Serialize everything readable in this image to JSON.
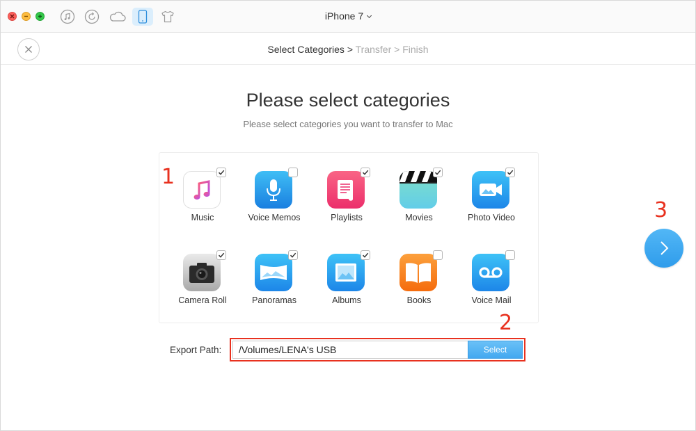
{
  "window": {
    "device_name": "iPhone 7"
  },
  "toolbar": {
    "icons": [
      "music-note-icon",
      "refresh-icon",
      "cloud-icon",
      "phone-icon",
      "shirt-icon"
    ],
    "active": "phone-icon"
  },
  "breadcrumb": {
    "step1": "Select Categories",
    "sep1": " > ",
    "step2": "Transfer",
    "sep2": " > ",
    "step3": "Finish"
  },
  "main": {
    "title": "Please select categories",
    "subtitle": "Please select categories you want to transfer to Mac"
  },
  "categories": [
    {
      "label": "Music",
      "checked": true
    },
    {
      "label": "Voice Memos",
      "checked": false
    },
    {
      "label": "Playlists",
      "checked": true
    },
    {
      "label": "Movies",
      "checked": true
    },
    {
      "label": "Photo Video",
      "checked": true
    },
    {
      "label": "Camera Roll",
      "checked": true
    },
    {
      "label": "Panoramas",
      "checked": true
    },
    {
      "label": "Albums",
      "checked": true
    },
    {
      "label": "Books",
      "checked": false
    },
    {
      "label": "Voice Mail",
      "checked": false
    }
  ],
  "annotations": {
    "one": "1",
    "two": "2",
    "three": "3"
  },
  "export": {
    "label": "Export Path:",
    "path": "/Volumes/LENA's USB",
    "button": "Select"
  },
  "colors": {
    "accent": "#3fa7f0",
    "annotation": "#e8311f"
  }
}
